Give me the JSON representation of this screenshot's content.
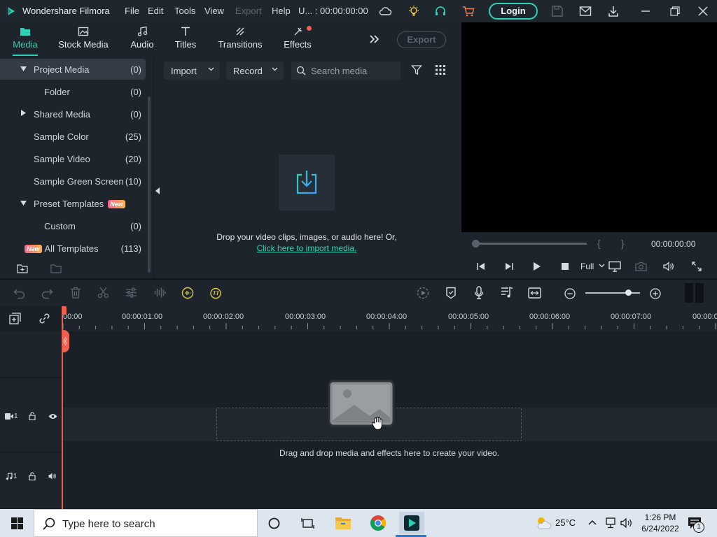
{
  "titlebar": {
    "app_name": "Wondershare Filmora",
    "menus": [
      "File",
      "Edit",
      "Tools",
      "View",
      "Export",
      "Help"
    ],
    "project_status": "U... : 00:00:00:00",
    "login_label": "Login"
  },
  "media_tabs": [
    {
      "label": "Media",
      "icon": "folder-icon",
      "active": true
    },
    {
      "label": "Stock Media",
      "icon": "image-icon"
    },
    {
      "label": "Audio",
      "icon": "music-note-icon"
    },
    {
      "label": "Titles",
      "icon": "text-t-icon"
    },
    {
      "label": "Transitions",
      "icon": "transition-icon"
    },
    {
      "label": "Effects",
      "icon": "effects-icon",
      "has_notification": true
    }
  ],
  "export_label": "Export",
  "sidebar": {
    "items": [
      {
        "name": "Project Media",
        "count": "(0)"
      },
      {
        "name": "Folder",
        "count": "(0)"
      },
      {
        "name": "Shared Media",
        "count": "(0)"
      },
      {
        "name": "Sample Color",
        "count": "(25)"
      },
      {
        "name": "Sample Video",
        "count": "(20)"
      },
      {
        "name": "Sample Green Screen",
        "count": "(10)"
      },
      {
        "name": "Preset Templates",
        "badge": "New"
      },
      {
        "name": "Custom",
        "count": "(0)"
      },
      {
        "name": "All Templates",
        "count": "(113)",
        "badge": "New"
      }
    ]
  },
  "media_toolbar": {
    "import_label": "Import",
    "record_label": "Record",
    "search_placeholder": "Search media"
  },
  "media_empty": {
    "drop_text": "Drop your video clips, images, or audio here! Or,",
    "import_link": "Click here to import media."
  },
  "preview": {
    "timecode": "00:00:00:00",
    "quality": "Full",
    "brace_open": "{",
    "brace_close": "}"
  },
  "timeline": {
    "ruler_labels": [
      "00:00",
      "00:00:01:00",
      "00:00:02:00",
      "00:00:03:00",
      "00:00:04:00",
      "00:00:05:00",
      "00:00:06:00",
      "00:00:07:00",
      "00:00:0"
    ],
    "video_track_number": "1",
    "audio_track_number": "1",
    "drag_text": "Drag and drop media and effects here to create your video."
  },
  "taskbar": {
    "search_placeholder": "Type here to search",
    "temperature": "25°C",
    "time": "1:26 PM",
    "date": "6/24/2022",
    "notification_count": "1"
  },
  "colors": {
    "accent": "#2fd1b6",
    "playhead": "#f0604f",
    "panel": "#1d242b"
  }
}
